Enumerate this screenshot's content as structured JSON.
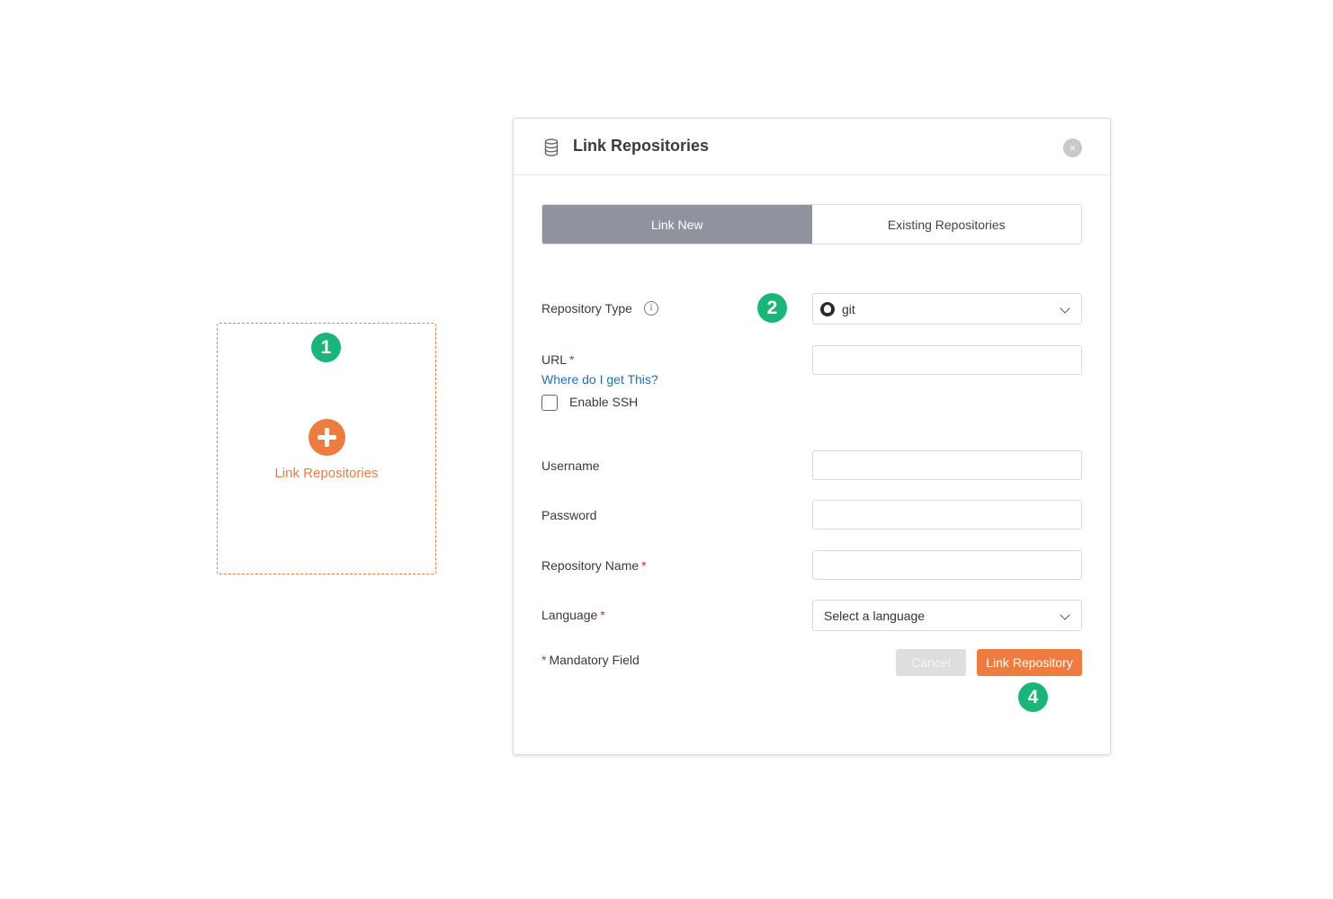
{
  "card": {
    "label": "Link Repositories"
  },
  "badges": {
    "step1": "1",
    "step2": "2",
    "step4": "4"
  },
  "modal": {
    "title": "Link Repositories",
    "close_symbol": "×",
    "tabs": [
      {
        "label": "Link New",
        "active": true
      },
      {
        "label": "Existing Repositories",
        "active": false
      }
    ],
    "form": {
      "repository_type_label": "Repository Type",
      "repository_type_value": "git",
      "info_symbol": "i",
      "url_label": "URL",
      "url_help_link": "Where do I get This?",
      "enable_ssh_label": "Enable SSH",
      "enable_ssh_checked": false,
      "username_label": "Username",
      "password_label": "Password",
      "repository_name_label": "Repository Name",
      "language_label": "Language",
      "language_placeholder": "Select a language",
      "required_marker": "*",
      "mandatory_note": "Mandatory Field"
    },
    "buttons": {
      "cancel": "Cancel",
      "submit": "Link Repository"
    }
  },
  "colors": {
    "accent": "#ee7b3f",
    "badge": "#1bb57a",
    "tab_active": "#8f939e",
    "link": "#1f6fb5",
    "required": "#e02828"
  },
  "icons": [
    "plus-icon",
    "database-icon",
    "close-icon",
    "info-icon",
    "github-icon",
    "chevron-down-icon"
  ]
}
